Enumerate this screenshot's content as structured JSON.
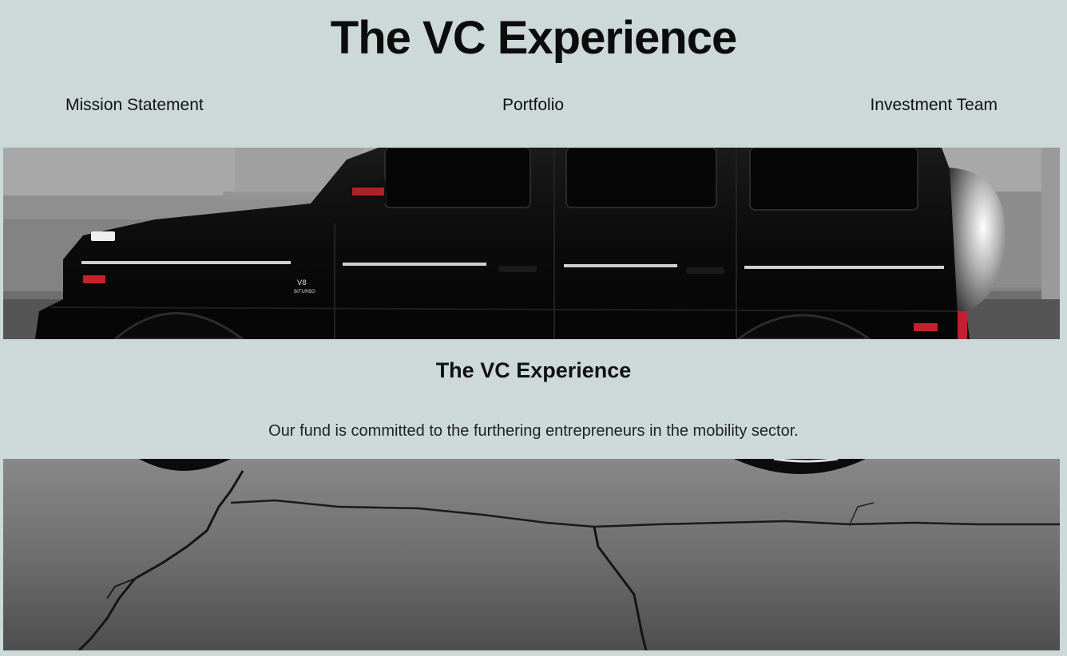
{
  "header": {
    "title": "The VC Experience"
  },
  "nav": {
    "items": [
      {
        "label": "Mission Statement"
      },
      {
        "label": "Portfolio"
      },
      {
        "label": "Investment Team"
      }
    ]
  },
  "hero": {
    "image_top": "black-suv-photo",
    "image_bottom": "cracked-asphalt-photo",
    "badge_text": "V8 BITURBO"
  },
  "section": {
    "title": "The VC Experience",
    "text": "Our fund is committed to the furthering entrepreneurs in the mobility sector."
  },
  "colors": {
    "background": "#cdd8d8",
    "text": "#111111"
  }
}
